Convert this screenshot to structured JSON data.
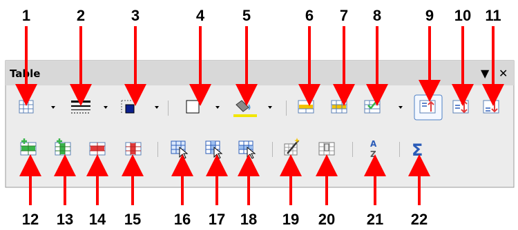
{
  "toolbar": {
    "title": "Table",
    "menu_glyph": "▼",
    "close_glyph": "✕"
  },
  "callout_numbers": [
    "1",
    "2",
    "3",
    "4",
    "5",
    "6",
    "7",
    "8",
    "9",
    "10",
    "11",
    "12",
    "13",
    "14",
    "15",
    "16",
    "17",
    "18",
    "19",
    "20",
    "21",
    "22"
  ],
  "tools_row1": [
    {
      "num": "1",
      "icon": "table-icon",
      "has_dropdown": true
    },
    {
      "num": "2",
      "icon": "line-style-icon",
      "has_dropdown": true
    },
    {
      "num": "3",
      "icon": "border-color-icon",
      "has_dropdown": true
    },
    {
      "num": "4",
      "icon": "borders-icon",
      "has_dropdown": true
    },
    {
      "num": "5",
      "icon": "background-fill-icon",
      "has_dropdown": true
    },
    {
      "num": "6",
      "icon": "merge-cells-icon",
      "has_dropdown": false
    },
    {
      "num": "7",
      "icon": "split-cells-icon",
      "has_dropdown": false
    },
    {
      "num": "8",
      "icon": "optimize-icon",
      "has_dropdown": true
    },
    {
      "num": "9",
      "icon": "align-top-icon",
      "has_dropdown": false,
      "selected": true
    },
    {
      "num": "10",
      "icon": "align-center-vertical-icon",
      "has_dropdown": false
    },
    {
      "num": "11",
      "icon": "align-bottom-icon",
      "has_dropdown": false
    }
  ],
  "tools_row2": [
    {
      "num": "12",
      "icon": "insert-rows-icon"
    },
    {
      "num": "13",
      "icon": "insert-columns-icon"
    },
    {
      "num": "14",
      "icon": "delete-rows-icon"
    },
    {
      "num": "15",
      "icon": "delete-columns-icon"
    },
    {
      "num": "16",
      "icon": "select-table-icon"
    },
    {
      "num": "17",
      "icon": "select-column-icon"
    },
    {
      "num": "18",
      "icon": "select-row-icon"
    },
    {
      "num": "19",
      "icon": "autoformat-icon"
    },
    {
      "num": "20",
      "icon": "table-properties-icon"
    },
    {
      "num": "21",
      "icon": "sort-icon",
      "glyph_top": "A",
      "glyph_bottom": "Z"
    },
    {
      "num": "22",
      "icon": "sum-icon",
      "glyph": "Σ"
    }
  ],
  "colors": {
    "arrow": "#ff0000",
    "grid_blue": "#5a7fb5",
    "header_bg": "#d6d6d6",
    "yellow": "#f2e600",
    "green": "#39b54a",
    "red_fill": "#e23a3a",
    "selected_border": "#4d7fc4"
  }
}
